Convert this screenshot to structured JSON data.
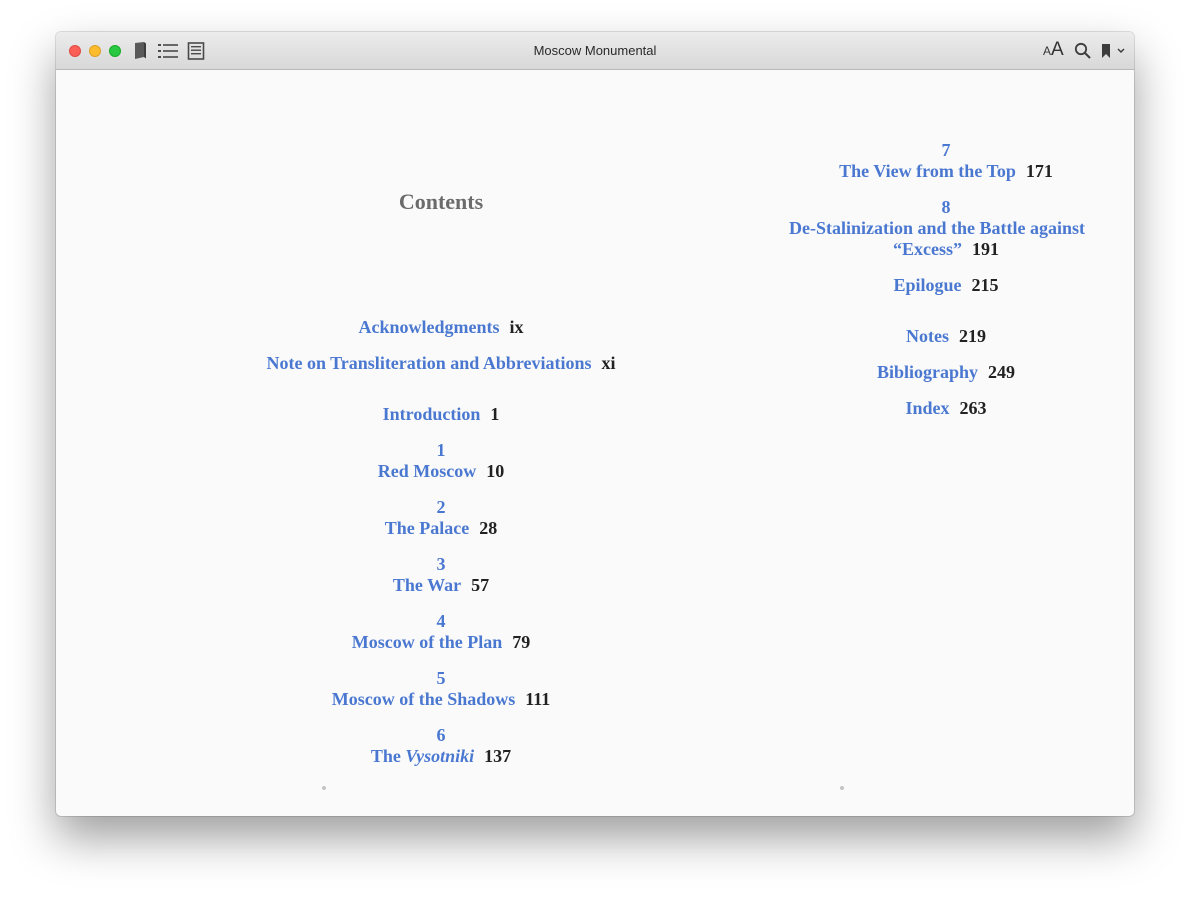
{
  "window": {
    "title": "Moscow Monumental"
  },
  "toolbar": {
    "font_small_label": "A",
    "font_large_label": "A"
  },
  "contents_heading": "Contents",
  "left_entries": [
    {
      "title": "Acknowledgments",
      "page": "ix"
    },
    {
      "title": "Note on Transliteration and Abbreviations",
      "page": "xi"
    },
    {
      "title": "Introduction",
      "page": "1"
    },
    {
      "num": "1",
      "title": "Red Moscow",
      "page": "10"
    },
    {
      "num": "2",
      "title": "The Palace",
      "page": "28"
    },
    {
      "num": "3",
      "title": "The War",
      "page": "57"
    },
    {
      "num": "4",
      "title": "Moscow of the Plan",
      "page": "79"
    },
    {
      "num": "5",
      "title": "Moscow of the Shadows",
      "page": "111"
    },
    {
      "num": "6",
      "title_prefix": "The",
      "title_italic": "Vysotniki",
      "page": "137"
    }
  ],
  "right_entries": [
    {
      "num": "7",
      "title": "The View from the Top",
      "page": "171"
    },
    {
      "num": "8",
      "title_line1": "De-Stalinization and the Battle against",
      "title_line2": "“Excess”",
      "page": "191"
    },
    {
      "title": "Epilogue",
      "page": "215"
    },
    {
      "title": "Notes",
      "page": "219"
    },
    {
      "title": "Bibliography",
      "page": "249"
    },
    {
      "title": "Index",
      "page": "263"
    }
  ]
}
